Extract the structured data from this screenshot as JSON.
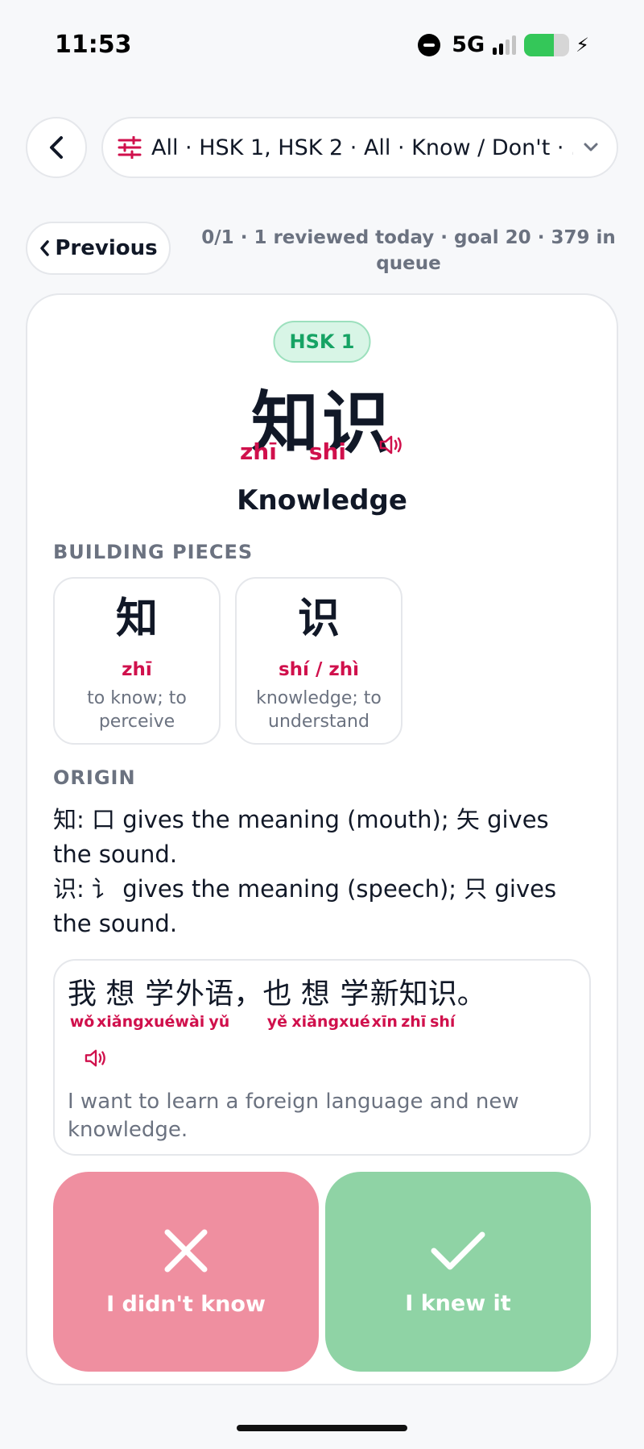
{
  "status_bar": {
    "time": "11:53",
    "network": "5G",
    "signal_level": 0.5,
    "battery_level": 0.65,
    "battery_color": "#34c759"
  },
  "header": {
    "back_icon": "chevron-left-icon",
    "filter_icon": "sliders-icon",
    "filter_summary": "All · HSK 1, HSK 2 · All · Know / Don't · ...",
    "dropdown_icon": "chevron-down-icon"
  },
  "navigation": {
    "previous_label": "Previous",
    "progress_text": "0/1 · 1 reviewed today · goal 20 · 379 in queue"
  },
  "card": {
    "level_badge": "HSK 1",
    "hanzi": "知识",
    "pinyin": [
      "zhī",
      "shi"
    ],
    "meaning": "Knowledge",
    "speaker_icon": "speaker-icon",
    "building_pieces_label": "BUILDING PIECES",
    "pieces": [
      {
        "char": "知",
        "pinyin": "zhī",
        "meaning": "to know; to perceive"
      },
      {
        "char": "识",
        "pinyin": "shí / zhì",
        "meaning": "knowledge; to understand"
      }
    ],
    "origin_label": "ORIGIN",
    "origin": [
      "知: 口 gives the meaning (mouth); 矢 gives the sound.",
      "识: 讠 gives the meaning (speech); 只 gives the sound."
    ],
    "example": {
      "tokens": [
        {
          "h": "我",
          "p": "wǒ"
        },
        {
          "h": "想",
          "p": "xiǎng"
        },
        {
          "h": "学",
          "p": "xué"
        },
        {
          "h": "外",
          "p": "wài"
        },
        {
          "h": "语",
          "p": "yǔ"
        },
        {
          "h": "，",
          "p": ""
        },
        {
          "h": "也",
          "p": "yě"
        },
        {
          "h": "想",
          "p": "xiǎng"
        },
        {
          "h": "学",
          "p": "xué"
        },
        {
          "h": "新",
          "p": "xīn"
        },
        {
          "h": "知",
          "p": "zhī"
        },
        {
          "h": "识",
          "p": "shí"
        },
        {
          "h": "。",
          "p": ""
        }
      ],
      "translation": "I want to learn a foreign language and new knowledge."
    }
  },
  "actions": {
    "didnt_know_label": "I didn't know",
    "knew_it_label": "I knew it",
    "didnt_know_color": "#ef8fa0",
    "knew_it_color": "#8fd3a5",
    "didnt_know_icon": "x-icon",
    "knew_it_icon": "check-icon"
  },
  "accent_colors": {
    "pinyin": "#d0104c",
    "hsk_badge": "#16a364"
  }
}
